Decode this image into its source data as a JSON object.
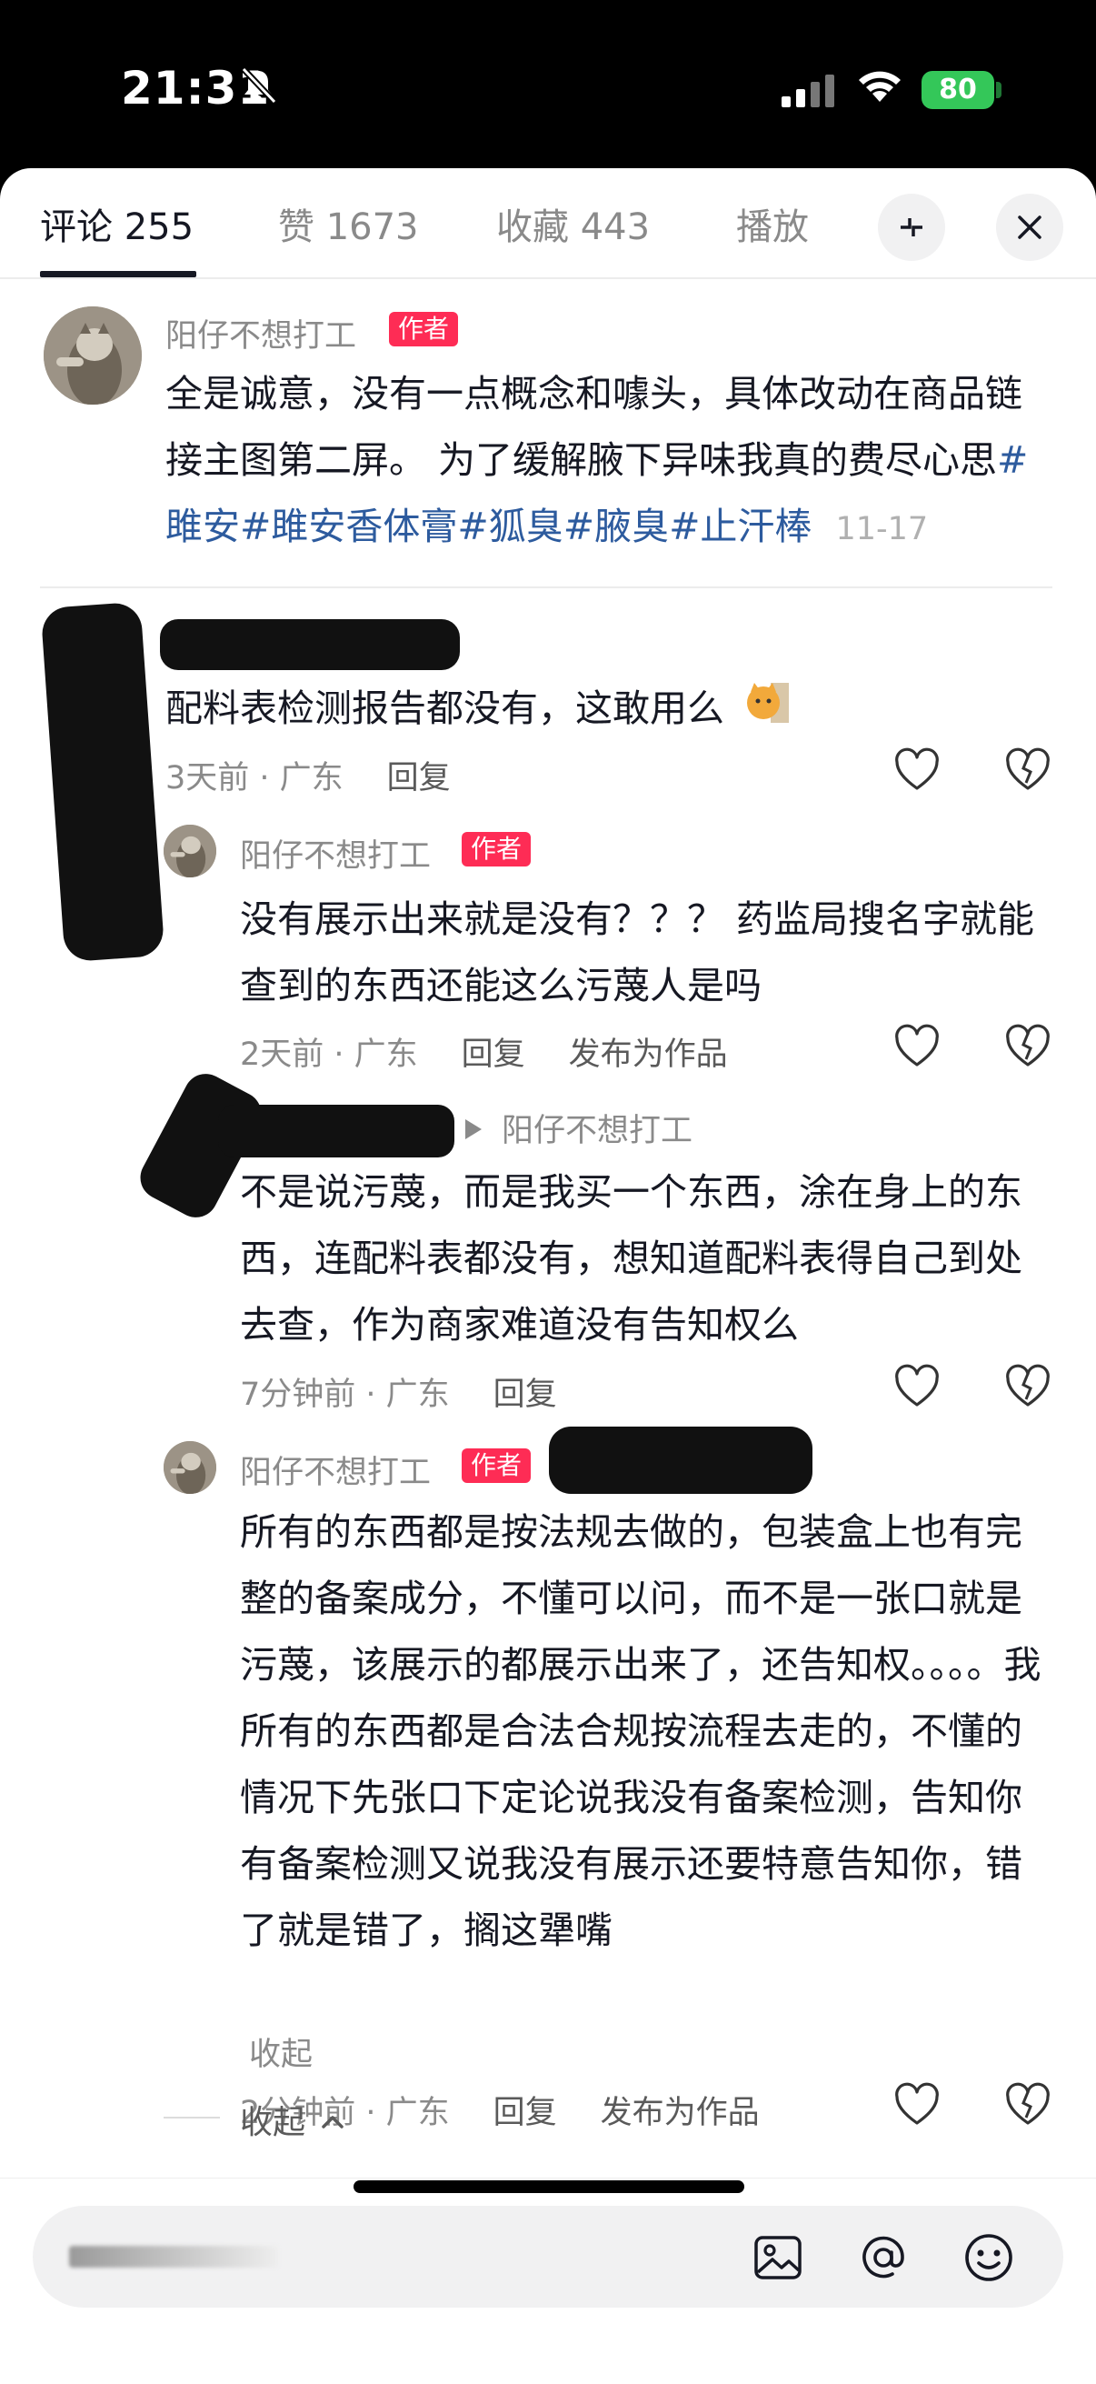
{
  "status_bar": {
    "time": "21:31",
    "battery": "80"
  },
  "tabs": [
    {
      "label": "评论 255",
      "active": true
    },
    {
      "label": "赞 1673",
      "active": false
    },
    {
      "label": "收藏 443",
      "active": false
    },
    {
      "label": "播放",
      "active": false
    }
  ],
  "comments": {
    "c1": {
      "user": "阳仔不想打工",
      "tag": "作者",
      "text": "全是诚意，没有一点概念和噱头，具体改动在商品链接主图第二屏。 为了缓解腋下异味我真的费尽心思",
      "hashtags": [
        "#雎安",
        "#雎安香体膏",
        "#狐臭",
        "#腋臭",
        "#止汗棒"
      ],
      "time": "11-17"
    },
    "c2": {
      "text": "配料表检测报告都没有，这敢用么",
      "time": "3天前 · 广东",
      "reply": "回复"
    },
    "r1": {
      "user": "阳仔不想打工",
      "tag": "作者",
      "text": "没有展示出来就是没有？？？ 药监局搜名字就能查到的东西还能这么污蔑人是吗",
      "time": "2天前 · 广东",
      "reply": "回复",
      "publish": "发布为作品"
    },
    "r2": {
      "reply_to": "阳仔不想打工",
      "text": "不是说污蔑，而是我买一个东西，涂在身上的东西，连配料表都没有，想知道配料表得自己到处去查，作为商家难道没有告知权么",
      "time": "7分钟前 · 广东",
      "reply": "回复"
    },
    "r3": {
      "user": "阳仔不想打工",
      "tag": "作者",
      "text": "所有的东西都是按法规去做的，包装盒上也有完整的备案成分，不懂可以问，而不是一张口就是污蔑，该展示的都展示出来了，还告知权。。。。我所有的东西都是合法合规按流程去走的，不懂的情况下先张口下定论说我没有备案检测，告知你有备案检测又说我没有展示还要特意告知你，错了就是错了，搁这犟嘴",
      "collapse": "收起",
      "time": "2分钟前 · 广东",
      "reply": "回复",
      "publish": "发布为作品"
    }
  },
  "collapse_all": "收起",
  "colors": {
    "author_tag": "#fe2c55",
    "hashtag": "#2d5b9e",
    "battery": "#34c759"
  }
}
